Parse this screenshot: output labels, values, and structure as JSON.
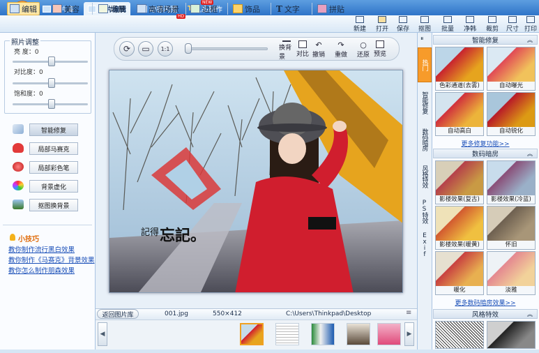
{
  "tabs": [
    {
      "label": "图片库"
    },
    {
      "label": "图片编辑"
    },
    {
      "label": "动感闪图"
    },
    {
      "label": "礼品制作"
    }
  ],
  "new_badge": "NEW",
  "tools": {
    "edit": "编辑",
    "beautify": "美容",
    "scene": "场景",
    "hd_scene": "高清场景",
    "border": "边框",
    "accessory": "饰品",
    "text": "文字",
    "collage": "拼贴",
    "hd_badge": "HD"
  },
  "actions": {
    "new": "新建",
    "open": "打开",
    "save": "保存",
    "crop": "抠图",
    "batch": "批量",
    "clean": "净韩",
    "cut": "裁剪",
    "size": "尺寸",
    "print": "打印"
  },
  "adjust": {
    "title": "照片调整",
    "brightness": "亮  度：0",
    "contrast": "对比度：0",
    "saturation": "饱和度：0",
    "brightness_value": 0.52,
    "contrast_value": 0.52,
    "saturation_value": 0.52
  },
  "functions": [
    {
      "label": "智能修复"
    },
    {
      "label": "局部马赛克"
    },
    {
      "label": "局部彩色笔"
    },
    {
      "label": "背景虚化"
    },
    {
      "label": "抠图换背景"
    }
  ],
  "tips": {
    "title": "小技巧",
    "links": [
      "教你制作流行黑白效果",
      "教你制作《马赛克》背景效果",
      "教你怎么制作朋森效果"
    ]
  },
  "canvas_controls": {
    "change_bg": "换背景",
    "compare": "对比",
    "undo": "撤销",
    "redo": "重做",
    "restore": "还原",
    "preview": "预览",
    "zoom_value": 0.02
  },
  "photo": {
    "caption_small": "記得",
    "caption_big": "忘記。"
  },
  "status": {
    "back": "返回图片库",
    "filename": "001.jpg",
    "dimensions": "550×412",
    "path": "C:\\Users\\Thinkpad\\Desktop"
  },
  "vtabs": [
    {
      "label": "热门"
    },
    {
      "label": "智能修复"
    },
    {
      "label": "数码暗房"
    },
    {
      "label": "风格特效"
    },
    {
      "label": "PS特效"
    },
    {
      "label": "Exif"
    }
  ],
  "right_panel": {
    "sections": [
      {
        "title": "智能修复",
        "effects": [
          "色彩通道(去雾)",
          "自动曝光",
          "自动高白",
          "自动锐化"
        ],
        "more": "更多修复功能>>"
      },
      {
        "title": "数码暗房",
        "effects": [
          "影楼效果(复古)",
          "影楼效果(冷蓝)",
          "影楼效果(暖黄)",
          "怀旧",
          "暖化",
          "淡雅"
        ],
        "more": "更多数码暗房效果>>"
      },
      {
        "title": "风格特效",
        "effects": [
          "",
          ""
        ]
      }
    ]
  }
}
